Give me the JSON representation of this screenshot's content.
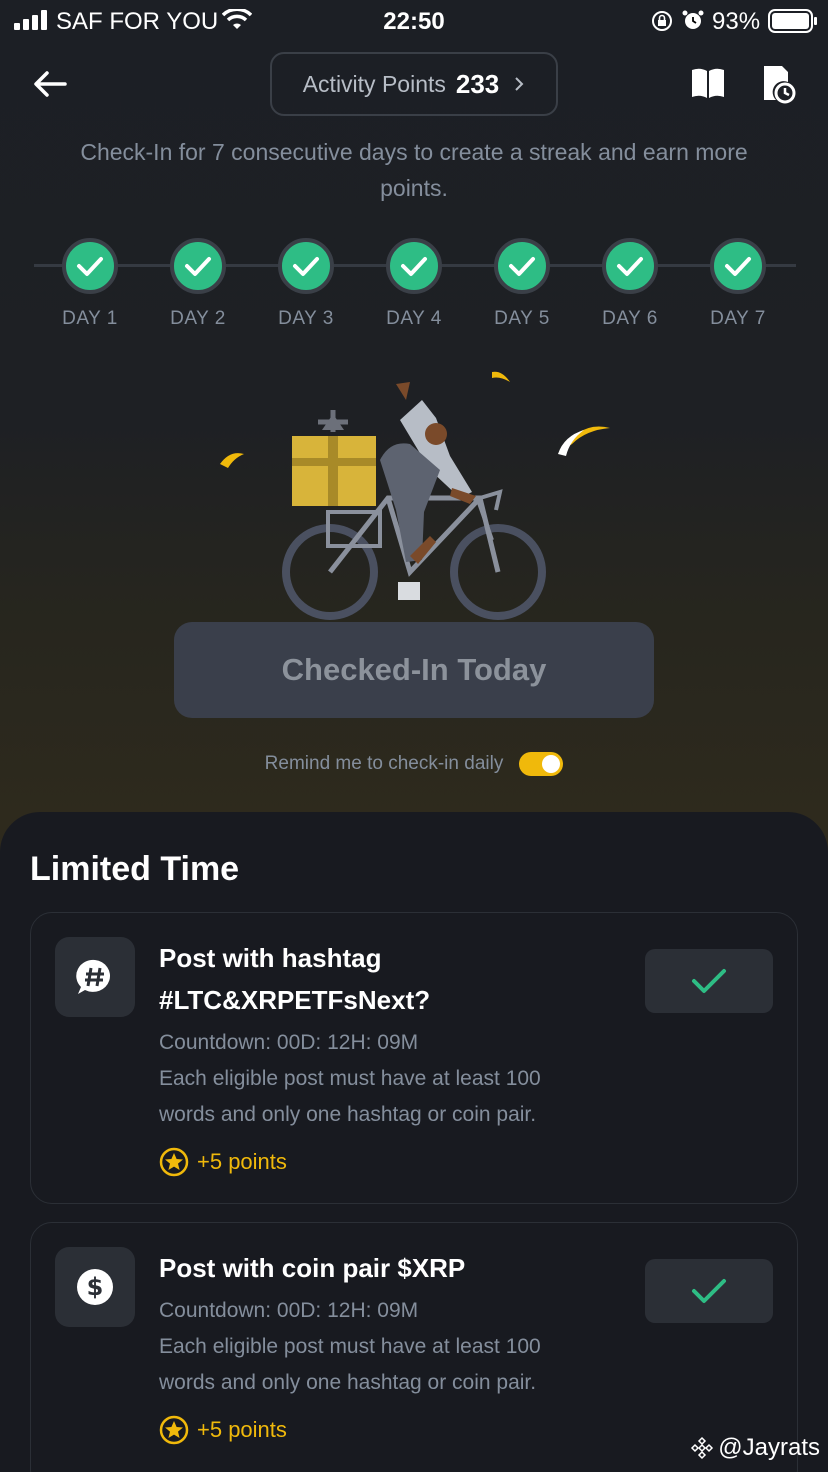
{
  "status_bar": {
    "carrier": "SAF FOR YOU",
    "time": "22:50",
    "battery": "93%"
  },
  "header": {
    "points_label": "Activity Points",
    "points_value": "233"
  },
  "intro_text": "Check-In for 7 consecutive days to create a streak and earn more points.",
  "streak": {
    "days": [
      "DAY 1",
      "DAY 2",
      "DAY 3",
      "DAY 4",
      "DAY 5",
      "DAY 6",
      "DAY 7"
    ],
    "completed": 7
  },
  "checkin": {
    "button_label": "Checked-In Today",
    "remind_label": "Remind me to check-in daily",
    "remind_enabled": true
  },
  "limited": {
    "title": "Limited Time",
    "tasks": [
      {
        "title_line1": "Post with hashtag",
        "title_line2": "#LTC&XRPETFsNext?",
        "countdown": "Countdown: 00D: 12H: 09M",
        "desc_line1": "Each eligible post must have at least 100",
        "desc_line2": "words and only one hashtag or coin pair.",
        "reward": "+5 points",
        "icon": "hashtag-chat-icon",
        "completed": true
      },
      {
        "title_line1": "Post with coin pair $XRP",
        "countdown": "Countdown: 00D: 12H: 09M",
        "desc_line1": "Each eligible post must have at least 100",
        "desc_line2": "words and only one hashtag or coin pair.",
        "reward": "+5 points",
        "icon": "dollar-coin-icon",
        "completed": true
      }
    ]
  },
  "watermark": "@Jayrats",
  "colors": {
    "accent": "#f0b90b",
    "success": "#2ebd85",
    "panel": "#181a20",
    "muted_text": "#848e9c"
  }
}
